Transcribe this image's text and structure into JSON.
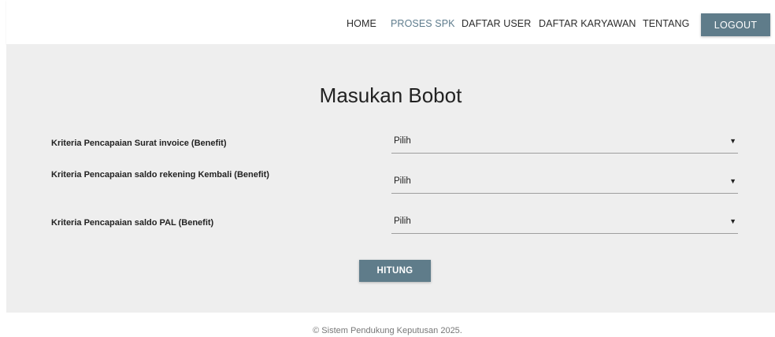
{
  "nav": {
    "items": [
      {
        "label": "HOME"
      },
      {
        "label": "PROSES SPK"
      },
      {
        "label": "DAFTAR USER"
      },
      {
        "label": "DAFTAR KARYAWAN"
      },
      {
        "label": "TENTANG"
      }
    ],
    "logout_label": "LOGOUT",
    "active_item": "PROSES SPK"
  },
  "main": {
    "title": "Masukan Bobot",
    "criteria": [
      {
        "label": "Kriteria Pencapaian Surat invoice (Benefit)",
        "selected": "Pilih"
      },
      {
        "label": "Kriteria Pencapaian saldo rekening Kembali (Benefit)",
        "selected": "Pilih"
      },
      {
        "label": "Kriteria Pencapaian saldo PAL (Benefit)",
        "selected": "Pilih"
      }
    ],
    "submit_label": "HITUNG"
  },
  "footer": {
    "text": "© Sistem Pendukung Keputusan 2025."
  },
  "icons": {
    "dropdown": "chevron-down-icon"
  },
  "colors": {
    "accent": "#5f7c8a",
    "active_nav": "#5d7b8c",
    "panel_bg": "#eeeeee"
  }
}
